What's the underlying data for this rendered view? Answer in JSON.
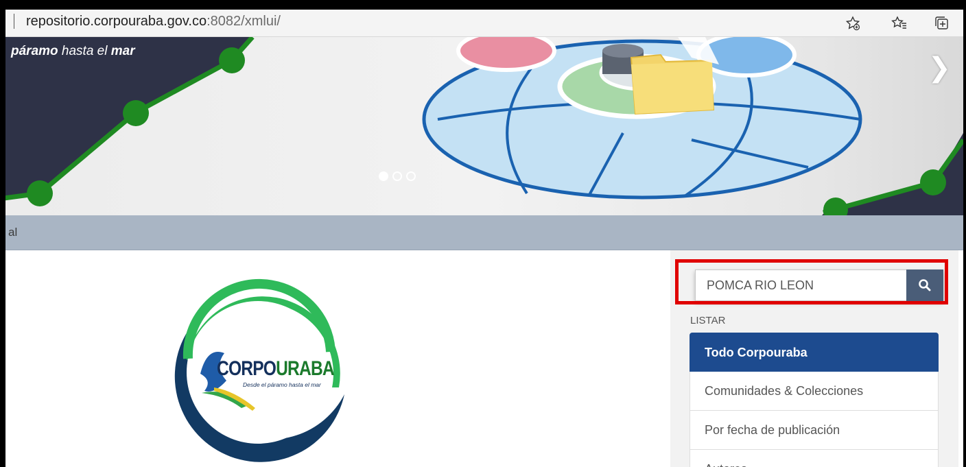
{
  "browser": {
    "url_main": "repositorio.corpouraba.gov.co",
    "url_port_path": ":8082/xmlui/",
    "icons": [
      "add-favorite-icon",
      "favorites-icon",
      "collections-icon"
    ]
  },
  "banner": {
    "tagline_part1": "páramo",
    "tagline_part2": " hasta el ",
    "tagline_part3": "mar",
    "next_glyph": "❯",
    "slide_count": 3,
    "active_slide": 1
  },
  "breadcrumb": {
    "text": "al"
  },
  "logo": {
    "corpo": "CORPO",
    "uraba": "URABA",
    "slogan": "Desde el páramo hasta el mar"
  },
  "sidebar": {
    "search_value": "POMCA RIO LEON",
    "listar_label": "LISTAR",
    "items": [
      {
        "label": "Todo Corpouraba",
        "active": true
      },
      {
        "label": "Comunidades & Colecciones",
        "active": false
      },
      {
        "label": "Por fecha de publicación",
        "active": false
      },
      {
        "label": "Autores",
        "active": false
      }
    ]
  },
  "colors": {
    "nav_active": "#1d4b8f",
    "search_button": "#4a5d78",
    "highlight": "#e00000",
    "crumb_bar": "#a9b5c4"
  }
}
